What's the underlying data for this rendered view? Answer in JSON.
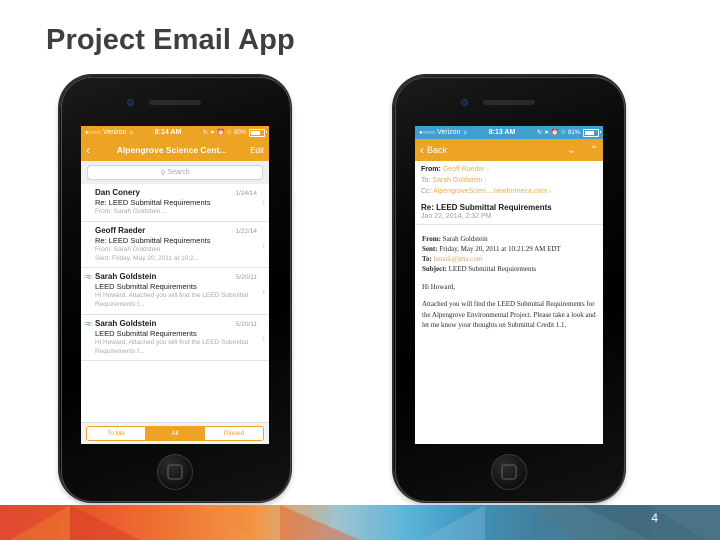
{
  "slide": {
    "title": "Project Email App",
    "page_number": "4"
  },
  "phone_left": {
    "name": "inbox-list-screen",
    "status_bar": {
      "signal_dots": "●○○○○",
      "carrier": "Verizon",
      "wifi_icon": "wifi-icon",
      "time": "8:14 AM",
      "rotation_lock_icon": "rotation-lock-icon",
      "location_icon": "location-arrow-icon",
      "alarm_icon": "alarm-icon",
      "bluetooth_icon": "bluetooth-icon",
      "battery_percent": "80%",
      "battery_icon": "battery-icon"
    },
    "navbar": {
      "back_icon": "chevron-left-icon",
      "title": "Alpengrove Science Cent...",
      "edit_label": "Edit"
    },
    "search": {
      "icon": "search-icon",
      "placeholder": "Search"
    },
    "messages": [
      {
        "sender": "Dan Conery",
        "date": "1/24/14",
        "subject": "Re: LEED Submittal Requirements",
        "preview": "From: Sarah Goldstein ...",
        "attachment": false
      },
      {
        "sender": "Geoff Raeder",
        "date": "1/22/14",
        "subject": "Re: LEED Submittal Requirements",
        "preview": "From: Sarah Goldstein\nSent: Friday, May 20, 2011 at 10:2...",
        "attachment": false
      },
      {
        "sender": "Sarah Goldstein",
        "date": "5/20/11",
        "subject": "LEED Submittal Requirements",
        "preview": "Hi Howard,    Attached you will find the LEED Submittal Requirements f...",
        "attachment": true
      },
      {
        "sender": "Sarah Goldstein",
        "date": "5/20/11",
        "subject": "LEED Submittal Requirements",
        "preview": "Hi Howard,    Attached you will find the LEED Submittal Requirements f...",
        "attachment": true
      }
    ],
    "segmented": {
      "options": [
        "To Me",
        "All",
        "Pinned"
      ],
      "selected": "All"
    }
  },
  "phone_right": {
    "name": "message-detail-screen",
    "status_bar": {
      "signal_dots": "●○○○○",
      "carrier": "Verizon",
      "wifi_icon": "wifi-icon",
      "time": "8:13 AM",
      "rotation_lock_icon": "rotation-lock-icon",
      "location_icon": "location-arrow-icon",
      "alarm_icon": "alarm-icon",
      "bluetooth_icon": "bluetooth-icon",
      "battery_percent": "81%",
      "battery_icon": "battery-icon"
    },
    "navbar": {
      "back_icon": "chevron-left-icon",
      "back_label": "Back",
      "prev_icon": "chevron-down-icon",
      "next_icon": "chevron-up-icon"
    },
    "headers": {
      "from_label": "From:",
      "from_value": "Geoff Raeder",
      "to_label": "To:",
      "to_value": "Sarah Goldstein",
      "cc_label": "Cc:",
      "cc_value": "AlpengroveScien....newformeca.com",
      "disclosure_icon": "chevron-right-icon"
    },
    "subject": "Re: LEED Submittal Requirements",
    "date": "Jan 22, 2014, 2:32 PM",
    "quoted": {
      "from_label": "From:",
      "from_value": "Sarah Goldstein",
      "sent_label": "Sent:",
      "sent_value": "Friday, May 20, 2011 at 10:21.29 AM EDT",
      "to_label": "To:",
      "to_value": "hmark@jma.com",
      "subject_label": "Subject:",
      "subject_value": "LEED Submittal Requirements"
    },
    "body": {
      "greeting": "Hi Howard,",
      "paragraph": "Attached you will find the LEED Submittal Requirements for the Alpengrove Environmental Project.  Please take a look and let me know your thoughts on Submittal Credit 1.1."
    },
    "toolbar": {
      "pin_icon": "pushpin-icon",
      "reply_icon": "reply-arrow-icon"
    }
  },
  "colors": {
    "accent_orange": "#eda323",
    "status_blue": "#3fa0d0",
    "title_gray": "#3f3f3f"
  }
}
